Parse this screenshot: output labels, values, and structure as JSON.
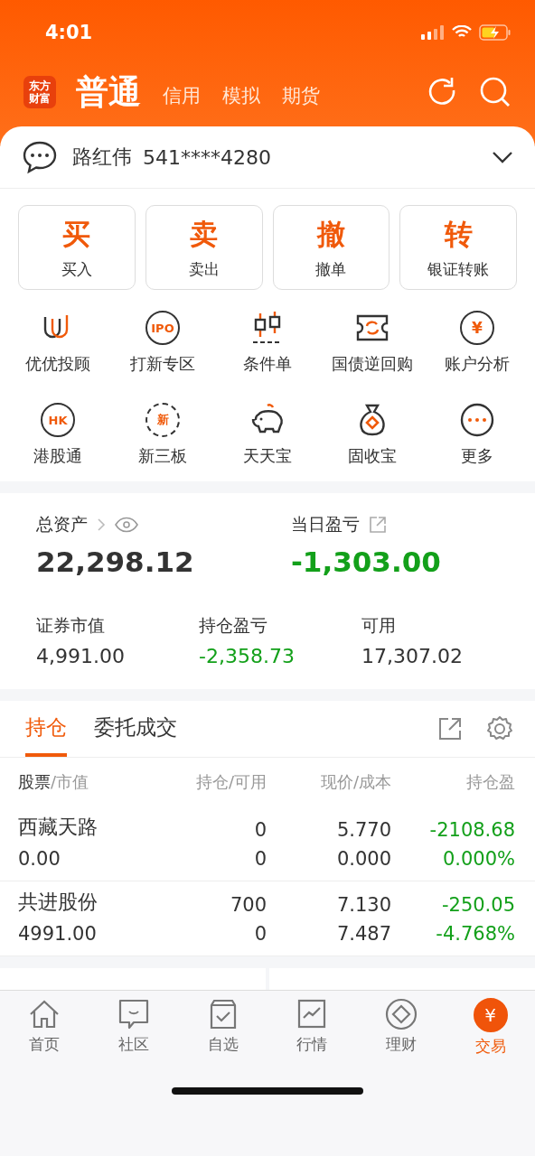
{
  "status_bar": {
    "time": "4:01"
  },
  "header": {
    "logo": [
      "东方",
      "财富"
    ],
    "modes": [
      {
        "label": "普通",
        "selected": true
      },
      {
        "label": "信用",
        "selected": false
      },
      {
        "label": "模拟",
        "selected": false
      },
      {
        "label": "期货",
        "selected": false
      }
    ]
  },
  "account": {
    "name": "路红伟",
    "number": "541****4280"
  },
  "trade_buttons": [
    {
      "glyph": "买",
      "label": "买入"
    },
    {
      "glyph": "卖",
      "label": "卖出"
    },
    {
      "glyph": "撤",
      "label": "撤单"
    },
    {
      "glyph": "转",
      "label": "银证转账"
    }
  ],
  "shortcuts": [
    {
      "label": "优优投顾"
    },
    {
      "label": "打新专区",
      "badge": "IPO"
    },
    {
      "label": "条件单"
    },
    {
      "label": "国债逆回购"
    },
    {
      "label": "账户分析",
      "badge": "¥"
    },
    {
      "label": "港股通",
      "badge": "HK"
    },
    {
      "label": "新三板",
      "badge": "新"
    },
    {
      "label": "天天宝"
    },
    {
      "label": "固收宝"
    },
    {
      "label": "更多"
    }
  ],
  "assets": {
    "total_label": "总资产",
    "total": "22,298.12",
    "daily_label": "当日盈亏",
    "daily": {
      "value": "-1,303.00",
      "color": "#13a01a"
    },
    "stats": [
      {
        "label": "证券市值",
        "value": "4,991.00",
        "color": "#333333"
      },
      {
        "label": "持仓盈亏",
        "value": "-2,358.73",
        "color": "#13a01a"
      },
      {
        "label": "可用",
        "value": "17,307.02",
        "color": "#333333"
      }
    ]
  },
  "position_tabs": [
    {
      "label": "持仓",
      "selected": true
    },
    {
      "label": "委托成交",
      "selected": false
    }
  ],
  "table": {
    "columns": [
      {
        "label": "股票",
        "secondary": "/市值"
      },
      {
        "label": "持仓/可用"
      },
      {
        "label": "现价/成本"
      },
      {
        "label": "持仓盈"
      }
    ],
    "rows": [
      {
        "name": "西藏天路",
        "market_value": "0.00",
        "holding": "0",
        "available": "0",
        "price": "5.770",
        "cost": "0.000",
        "pnl": "-2108.68",
        "pnl_pct": "0.000%",
        "color": "#13a01a"
      },
      {
        "name": "共进股份",
        "market_value": "4991.00",
        "holding": "700",
        "available": "0",
        "price": "7.130",
        "cost": "7.487",
        "pnl": "-250.05",
        "pnl_pct": "-4.768%",
        "color": "#13a01a"
      }
    ]
  },
  "tab_bar": [
    {
      "label": "首页",
      "selected": false
    },
    {
      "label": "社区",
      "selected": false
    },
    {
      "label": "自选",
      "selected": false
    },
    {
      "label": "行情",
      "selected": false
    },
    {
      "label": "理财",
      "selected": false
    },
    {
      "label": "交易",
      "selected": true,
      "badge": "¥"
    }
  ]
}
